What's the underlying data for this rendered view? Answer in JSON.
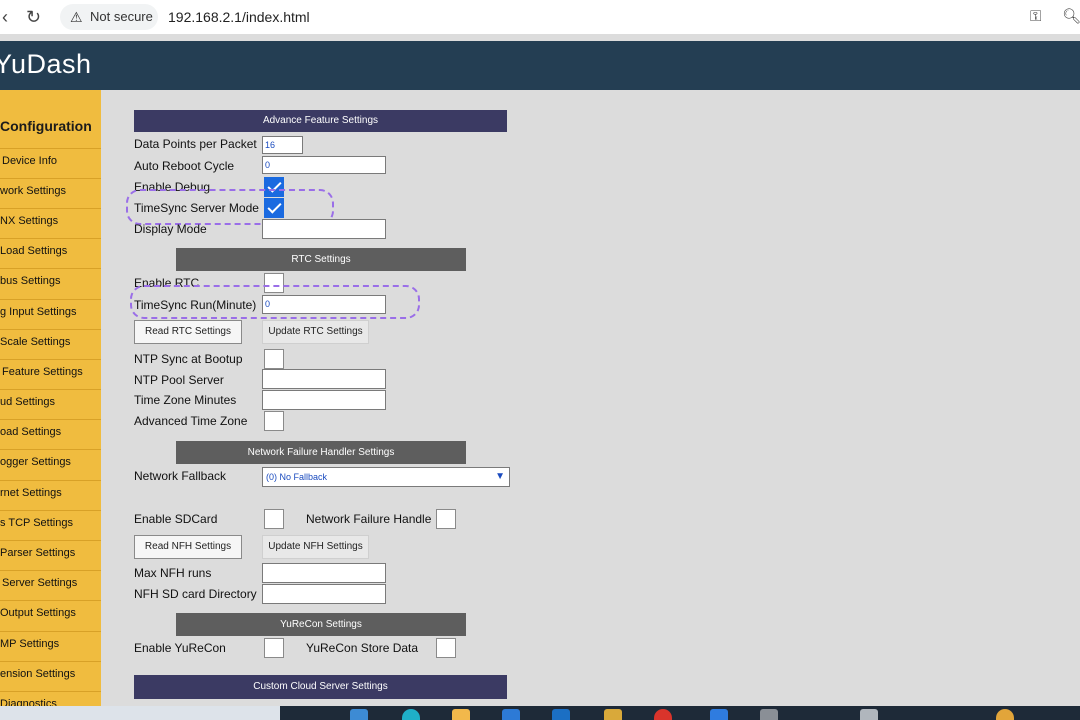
{
  "browser": {
    "security_label": "Not secure",
    "url": "192.168.2.1/index.html",
    "icons": [
      "back-icon",
      "reload-icon",
      "warning-icon",
      "key-icon",
      "zoom-icon"
    ]
  },
  "app": {
    "brand": "YuDash"
  },
  "sidebar": {
    "title": "Configuration",
    "items": [
      "Device Info",
      "work Settings",
      "NX Settings",
      "Load Settings",
      "bus Settings",
      "g Input Settings",
      "Scale Settings",
      "Feature Settings",
      "ud Settings",
      "oad Settings",
      "ogger Settings",
      "rnet Settings",
      "s TCP Settings",
      "Parser Settings",
      "Server Settings",
      "Output Settings",
      "MP Settings",
      "ension Settings",
      "Diagnostics"
    ]
  },
  "advance": {
    "title": "Advance Feature Settings",
    "data_points_label": "Data Points per Packet",
    "data_points_value": "16",
    "auto_reboot_label": "Auto Reboot Cycle",
    "auto_reboot_value": "0",
    "enable_debug_label": "Enable Debug",
    "enable_debug_checked": true,
    "timesync_server_label": "TimeSync Server Mode",
    "timesync_server_checked": true,
    "display_mode_label": "Display Mode",
    "display_mode_value": ""
  },
  "rtc": {
    "title": "RTC Settings",
    "enable_rtc_label": "Enable RTC",
    "enable_rtc_checked": false,
    "timesync_run_label": "TimeSync Run(Minute)",
    "timesync_run_value": "0",
    "read_button": "Read RTC Settings",
    "update_button": "Update RTC Settings",
    "ntp_bootup_label": "NTP Sync at Bootup",
    "ntp_pool_label": "NTP Pool Server",
    "ntp_pool_value": "",
    "tz_minutes_label": "Time Zone Minutes",
    "tz_minutes_value": "",
    "adv_tz_label": "Advanced Time Zone"
  },
  "nfh": {
    "title": "Network Failure Handler Settings",
    "fallback_label": "Network Fallback",
    "fallback_selected": "(0) No Fallback",
    "sdcard_label": "Enable SDCard",
    "nfh_handle_label": "Network Failure Handle",
    "read_button": "Read NFH Settings",
    "update_button": "Update NFH Settings",
    "max_runs_label": "Max NFH runs",
    "max_runs_value": "",
    "sd_dir_label": "NFH SD card Directory",
    "sd_dir_value": ""
  },
  "yurecon": {
    "title": "YuReCon Settings",
    "enable_label": "Enable YuReCon",
    "store_label": "YuReCon Store Data"
  },
  "custom_cloud": {
    "title": "Custom Cloud Server Settings"
  },
  "colors": {
    "header": "#243e53",
    "sidebar": "#f0bc3f",
    "section_dark": "#3b3a63",
    "section_gray": "#5e5e5e",
    "highlight": "#9a6ee8",
    "checkbox": "#1a6ae0"
  }
}
